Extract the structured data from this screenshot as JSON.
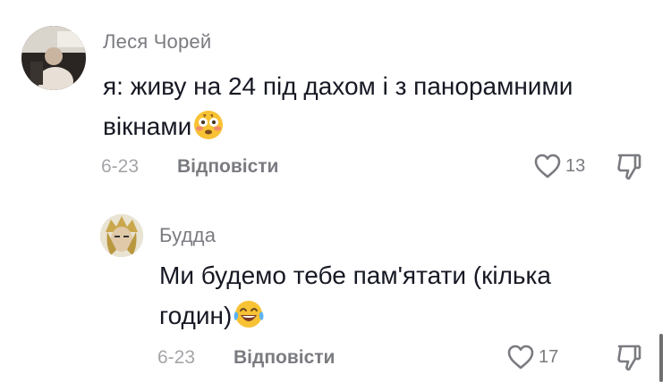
{
  "comments": [
    {
      "username": "Леся Чорей",
      "text": "я: живу на 24 під дахом і з панорамними вікнами",
      "emoji": "flushed-face-emoji",
      "date": "6-23",
      "reply_label": "Відповісти",
      "likes": "13"
    },
    {
      "username": "Будда",
      "text": "Ми будемо тебе пам'ятати (кілька годин)",
      "emoji": "tears-of-joy-emoji",
      "date": "6-23",
      "reply_label": "Відповісти",
      "likes": "17"
    }
  ],
  "icons": {
    "like": "heart-outline-icon",
    "dislike": "thumbs-down-icon"
  },
  "colors": {
    "text": "#161823",
    "secondary": "#7a7b80",
    "date": "#a4a5a9",
    "emoji_yellow": "#f7c234"
  }
}
